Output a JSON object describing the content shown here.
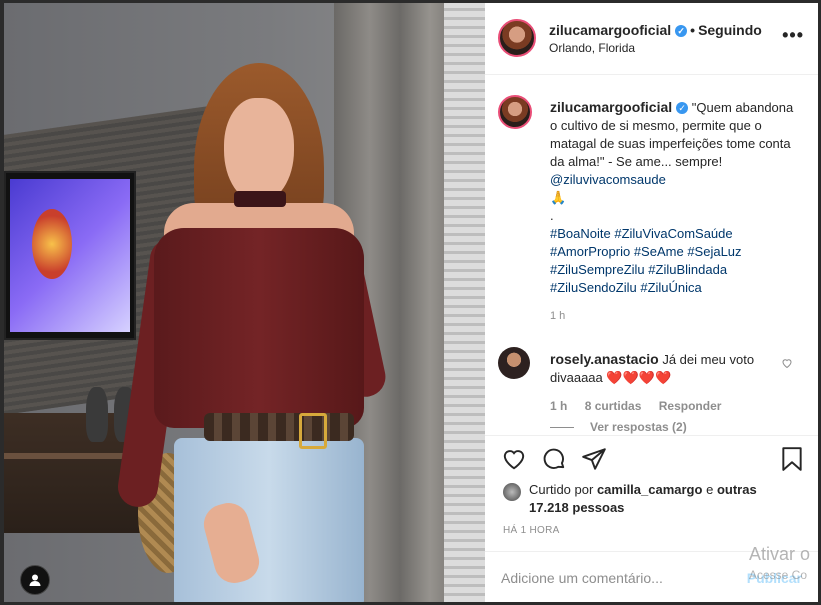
{
  "header": {
    "username": "zilucamargooficial",
    "dot": "•",
    "follow_status": "Seguindo",
    "location": "Orlando, Florida",
    "more": "•••"
  },
  "caption": {
    "username": "zilucamargooficial",
    "text": "\"Quem abandona o cultivo de si mesmo, permite que o matagal de suas imperfeições tome conta da alma!\" - Se ame... sempre!",
    "mention": "@ziluvivacomsaude",
    "emoji": "🙏",
    "separator": ".",
    "hashtags": [
      "#BoaNoite",
      "#ZiluVivaComSaúde",
      "#AmorProprio",
      "#SeAme",
      "#SejaLuz",
      "#ZiluSempreZilu",
      "#ZiluBlindada",
      "#ZiluSendoZilu",
      "#ZiluÚnica"
    ],
    "time": "1 h"
  },
  "comment": {
    "username": "rosely.anastacio",
    "text": "Já dei meu voto divaaaaa",
    "hearts": "❤️❤️❤️❤️",
    "time": "1 h",
    "likes": "8 curtidas",
    "reply": "Responder",
    "view_replies": "Ver respostas (2)"
  },
  "likes": {
    "prefix": "Curtido por",
    "user": "camilla_camargo",
    "connector": "e",
    "others": "outras 17.218 pessoas"
  },
  "timestamp": "HÁ 1 HORA",
  "add_comment": {
    "placeholder": "Adicione um comentário...",
    "publish": "Publicar"
  },
  "watermark": {
    "line1": "Ativar o",
    "line2": "Acesse Co"
  },
  "icons": {
    "like": "heart-icon",
    "comment": "comment-icon",
    "share": "share-icon",
    "save": "bookmark-icon",
    "user": "user-icon"
  },
  "colors": {
    "link": "#00376b",
    "verified": "#3897f0",
    "muted": "#8e8e8e",
    "publish_disabled": "#b2dffc"
  }
}
